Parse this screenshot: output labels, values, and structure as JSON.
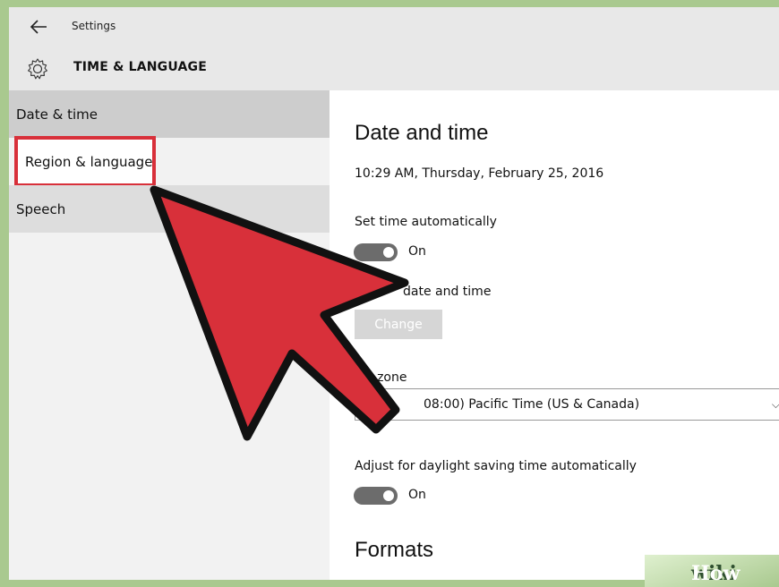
{
  "window": {
    "app_title": "Settings",
    "section_title": "TIME & LANGUAGE",
    "back_icon": "back-arrow-icon",
    "section_icon": "gear-icon"
  },
  "sidebar": {
    "items": [
      {
        "label": "Date & time",
        "state": "selected"
      },
      {
        "label": "Region & language",
        "state": "highlighted"
      },
      {
        "label": "Speech",
        "state": "hover"
      }
    ]
  },
  "main": {
    "heading": "Date and time",
    "current_datetime": "10:29 AM, Thursday, February 25, 2016",
    "set_time_auto": {
      "label": "Set time automatically",
      "state": "On"
    },
    "change_date": {
      "label": "date and time",
      "button": "Change"
    },
    "time_zone": {
      "label": "e zone",
      "value": "08:00) Pacific Time (US & Canada)"
    },
    "dst": {
      "label": "Adjust for daylight saving time automatically",
      "state": "On"
    },
    "formats_heading": "Formats"
  },
  "overlay": {
    "arrow_color": "#d8303a",
    "arrow_icon": "pointer-arrow-icon"
  },
  "watermark": {
    "part1": "wiki",
    "part2": "How"
  },
  "colors": {
    "accent_red": "#d8303a",
    "frame_green": "#a9c98f",
    "toggle_on": "#6c6c6c"
  }
}
